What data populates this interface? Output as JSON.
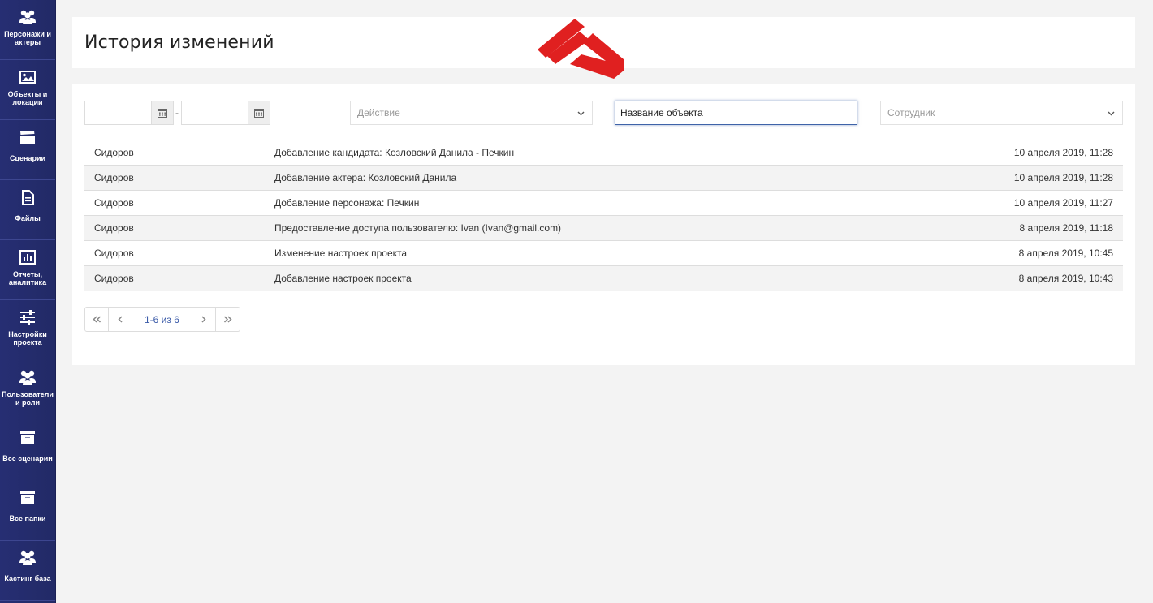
{
  "sidebar": {
    "items": [
      {
        "label": "Персонажи и актеры",
        "icon": "users-icon"
      },
      {
        "label": "Объекты и локации",
        "icon": "image-icon"
      },
      {
        "label": "Сценарии",
        "icon": "clapperboard-icon"
      },
      {
        "label": "Файлы",
        "icon": "file-icon"
      },
      {
        "label": "Отчеты, аналитика",
        "icon": "chart-icon"
      },
      {
        "label": "Настройки проекта",
        "icon": "sliders-icon"
      },
      {
        "label": "Пользователи и роли",
        "icon": "users-icon"
      },
      {
        "label": "Все сценарии",
        "icon": "archive-icon"
      },
      {
        "label": "Все папки",
        "icon": "archive-icon"
      },
      {
        "label": "Кастинг база",
        "icon": "users-icon"
      }
    ]
  },
  "header": {
    "title": "История изменений"
  },
  "filters": {
    "date_from": "",
    "date_separator": "-",
    "date_to": "",
    "action_placeholder": "Действие",
    "object_name_placeholder": "Название объекта",
    "employee_placeholder": "Сотрудник"
  },
  "table": {
    "rows": [
      {
        "user": "Сидоров",
        "action": "Добавление кандидата: Козловский Данила - Печкин",
        "date": "10 апреля 2019, 11:28"
      },
      {
        "user": "Сидоров",
        "action": "Добавление актера: Козловский Данила",
        "date": "10 апреля 2019, 11:28"
      },
      {
        "user": "Сидоров",
        "action": "Добавление персонажа: Печкин",
        "date": "10 апреля 2019, 11:27"
      },
      {
        "user": "Сидоров",
        "action": "Предоставление доступа пользователю: Ivan (Ivan@gmail.com)",
        "date": "8 апреля 2019, 11:18"
      },
      {
        "user": "Сидоров",
        "action": "Изменение настроек проекта",
        "date": "8 апреля 2019, 10:45"
      },
      {
        "user": "Сидоров",
        "action": "Добавление настроек проекта",
        "date": "8 апреля 2019, 10:43"
      }
    ]
  },
  "pagination": {
    "info": "1-6 из 6"
  },
  "colors": {
    "sidebar": "#262e73",
    "accent": "#3a5aa8",
    "arrow": "#e02020"
  }
}
